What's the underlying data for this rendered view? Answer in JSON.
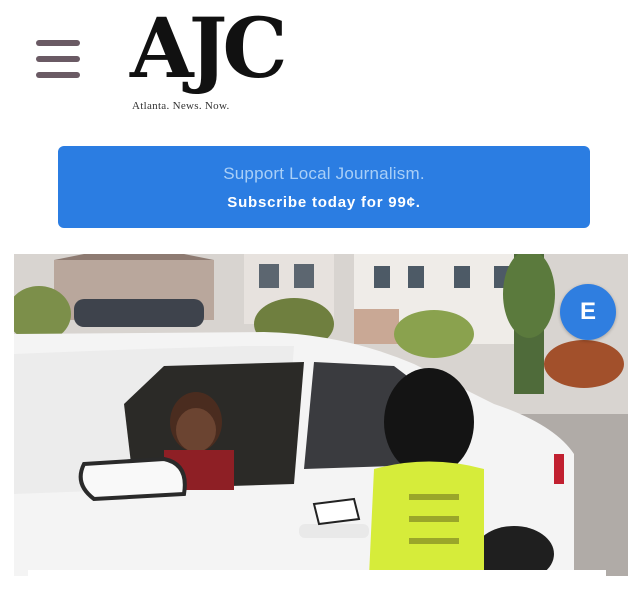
{
  "header": {
    "menu_icon": "hamburger-menu-icon",
    "logo_text": "AJC",
    "tagline": "Atlanta. News. Now."
  },
  "promo": {
    "title": "Support Local Journalism.",
    "cta": "Subscribe today for 99¢."
  },
  "floating_button": {
    "label": "E"
  },
  "colors": {
    "banner_background": "#2b7de2",
    "floating_button": "#2f7ee0",
    "menu_icon": "#6a5a64"
  }
}
